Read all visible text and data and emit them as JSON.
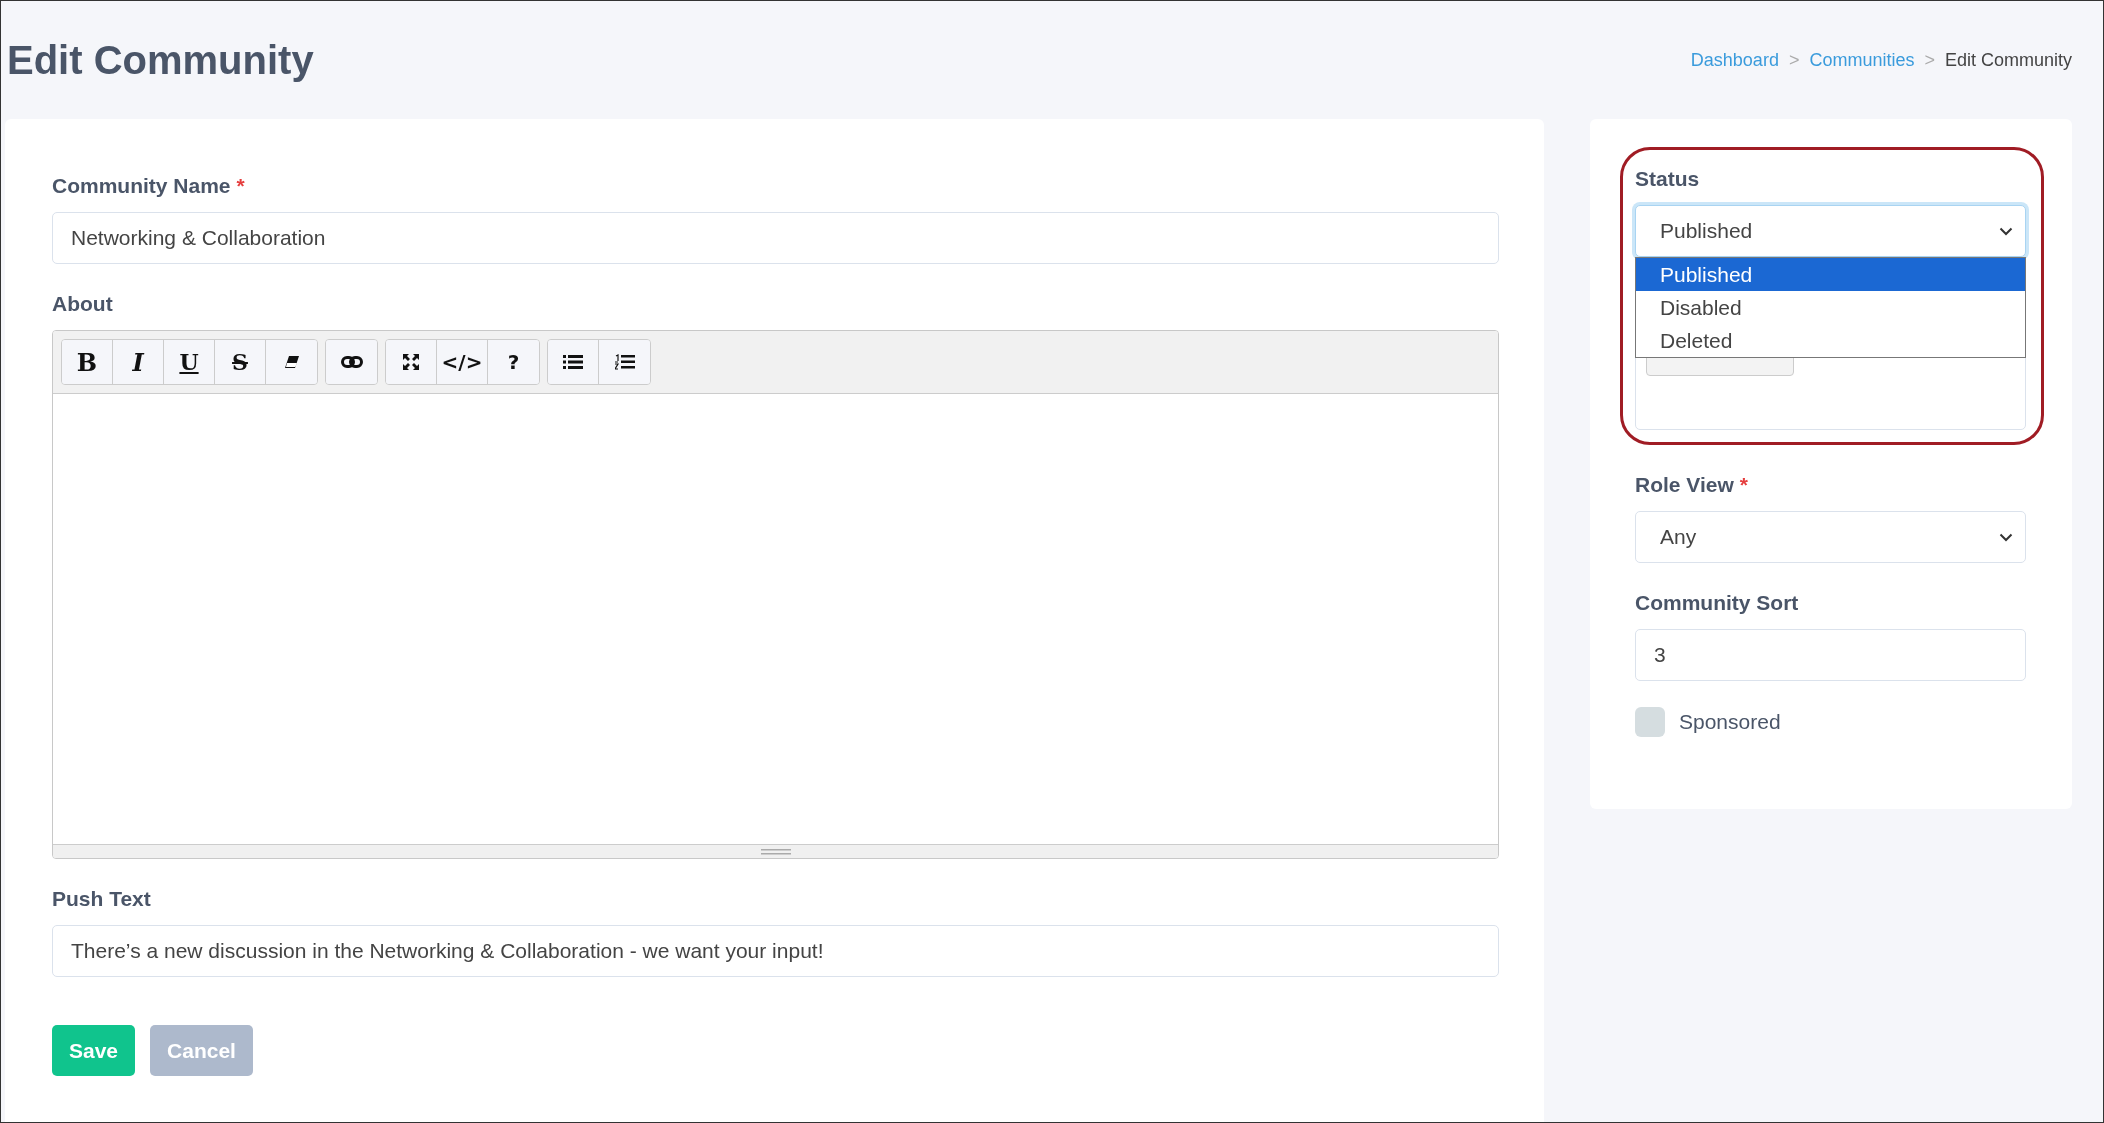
{
  "header": {
    "title": "Edit Community",
    "breadcrumb": [
      {
        "kind": "link",
        "text": "Dashboard"
      },
      {
        "kind": "separator",
        "text": ">"
      },
      {
        "kind": "link",
        "text": "Communities"
      },
      {
        "kind": "separator",
        "text": ">"
      },
      {
        "kind": "current",
        "text": "Edit Community"
      }
    ]
  },
  "form": {
    "community_name": {
      "label": "Community Name",
      "required_mark": "*",
      "value": "Networking & Collaboration"
    },
    "about": {
      "label": "About",
      "toolbar": [
        [
          {
            "kind": "bold",
            "text": "B"
          },
          {
            "kind": "italic",
            "text": "I"
          },
          {
            "kind": "underline",
            "text": "U"
          },
          {
            "kind": "strike",
            "text": "S"
          },
          {
            "kind": "eraser"
          }
        ],
        [
          {
            "kind": "link"
          }
        ],
        [
          {
            "kind": "expand"
          },
          {
            "kind": "text",
            "text": "</>"
          },
          {
            "kind": "text",
            "text": "?"
          }
        ],
        [
          {
            "kind": "bullet-list"
          },
          {
            "kind": "numbered-list"
          }
        ]
      ]
    },
    "push_text": {
      "label": "Push Text",
      "value": "There’s a new discussion in the Networking & Collaboration - we want your input!"
    },
    "buttons": [
      {
        "kind": "primary",
        "label": "Save"
      },
      {
        "kind": "secondary",
        "label": "Cancel"
      }
    ]
  },
  "sidebar": {
    "highlighted": true,
    "status": {
      "label": "Status",
      "value": "Published",
      "open": true,
      "options": [
        {
          "label": "Published",
          "selected": true
        },
        {
          "label": "Disabled",
          "selected": false
        },
        {
          "label": "Deleted",
          "selected": false
        }
      ]
    },
    "tags": [
      {
        "kind": "chip"
      }
    ],
    "role_view": {
      "label": "Role View",
      "required_mark": "*",
      "value": "Any"
    },
    "community_sort": {
      "label": "Community Sort",
      "value": "3"
    },
    "sponsored": {
      "label": "Sponsored",
      "checked": false
    }
  }
}
